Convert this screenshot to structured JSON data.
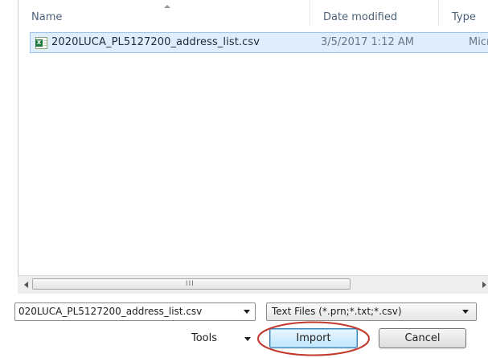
{
  "columns": {
    "name": "Name",
    "date_modified": "Date modified",
    "type": "Type"
  },
  "files": [
    {
      "name": "2020LUCA_PL5127200_address_list.csv",
      "date_modified": "3/5/2017 1:12 AM",
      "type": "Micros",
      "icon": "excel-csv-icon"
    }
  ],
  "scrollbar": {
    "grip": "III"
  },
  "file_name_field": {
    "value": "020LUCA_PL5127200_address_list.csv"
  },
  "file_type_filter": {
    "selected": "Text Files (*.prn;*.txt;*.csv)"
  },
  "buttons": {
    "tools": "Tools",
    "import": "Import",
    "cancel": "Cancel"
  },
  "colors": {
    "selection": "#e0edfb",
    "highlight_circle": "#c0392b",
    "header_text": "#4c607a"
  }
}
